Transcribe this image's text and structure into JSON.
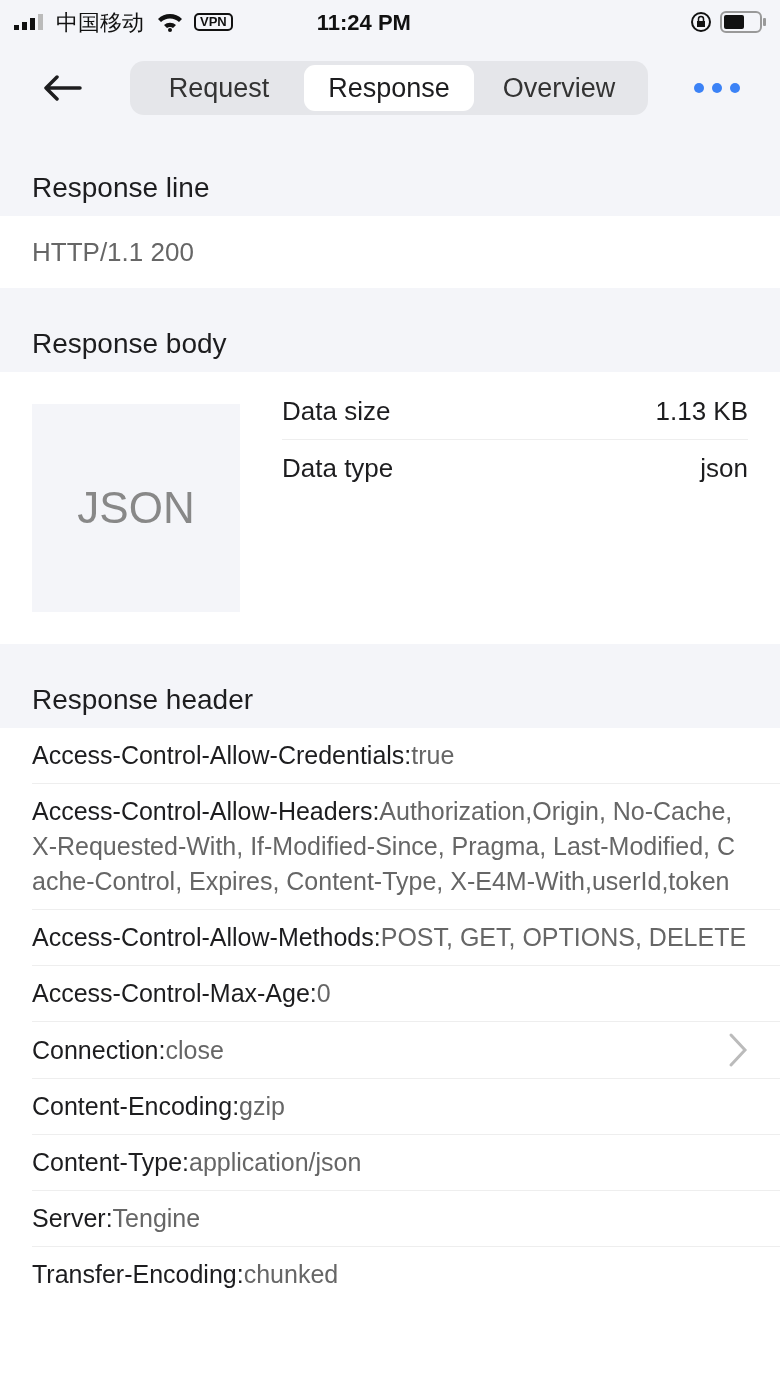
{
  "status_bar": {
    "carrier": "中国移动",
    "vpn": "VPN",
    "time": "11:24 PM"
  },
  "tabs": [
    {
      "label": "Request",
      "selected": false
    },
    {
      "label": "Response",
      "selected": true
    },
    {
      "label": "Overview",
      "selected": false
    }
  ],
  "response_line": {
    "title": "Response line",
    "value": "HTTP/1.1 200"
  },
  "response_body": {
    "title": "Response body",
    "preview": "JSON",
    "details": [
      {
        "label": "Data size",
        "value": "1.13 KB"
      },
      {
        "label": "Data type",
        "value": "json"
      }
    ]
  },
  "response_header": {
    "title": "Response header",
    "rows": [
      {
        "name": "Access-Control-Allow-Credentials:",
        "value": "true"
      },
      {
        "name": "Access-Control-Allow-Headers:",
        "value": "Authorization,Origin, No-Cache, X-Requested-With, If-Modified-Since, Pragma, Last-Modified, Cache-Control, Expires, Content-Type, X-E4M-With,userId,token"
      },
      {
        "name": "Access-Control-Allow-Methods:",
        "value": "POST, GET, OPTIONS, DELETE"
      },
      {
        "name": "Access-Control-Max-Age:",
        "value": "0"
      },
      {
        "name": "Connection:",
        "value": "close"
      },
      {
        "name": "Content-Encoding:",
        "value": "gzip"
      },
      {
        "name": "Content-Type:",
        "value": "application/json"
      },
      {
        "name": "Server:",
        "value": "Tengine"
      },
      {
        "name": "Transfer-Encoding:",
        "value": "chunked"
      }
    ]
  }
}
